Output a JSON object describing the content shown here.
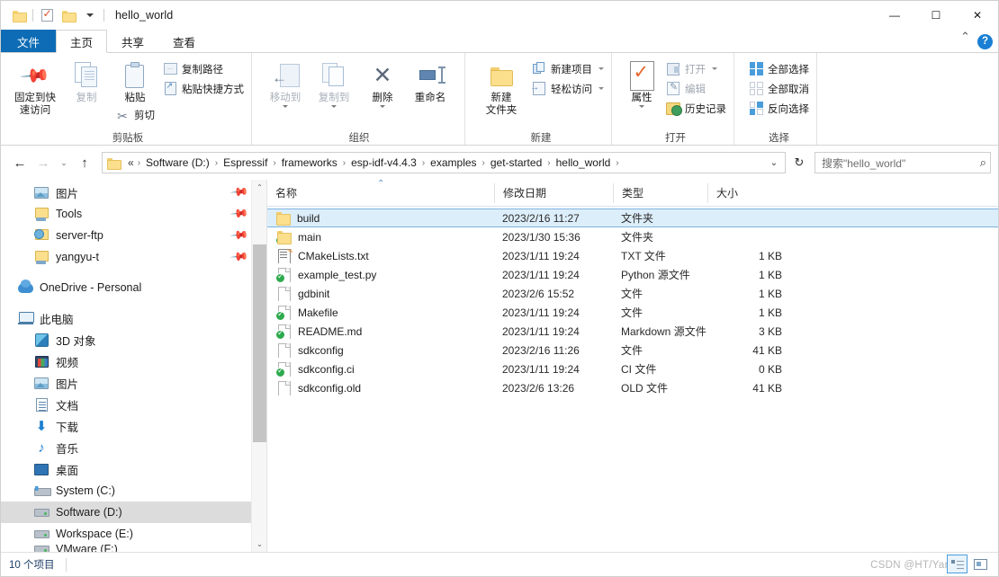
{
  "window": {
    "title": "hello_world",
    "minimize_label": "—",
    "maximize_label": "☐",
    "close_label": "✕"
  },
  "quick_access": {
    "folder_icon": "folder-icon",
    "properties_icon": "checkmark-document-icon",
    "new_folder_icon": "new-folder-icon",
    "customize_caret": "chevron-down-icon"
  },
  "ribbon": {
    "tabs": [
      {
        "label": "文件",
        "id": "file"
      },
      {
        "label": "主页",
        "id": "home"
      },
      {
        "label": "共享",
        "id": "share"
      },
      {
        "label": "查看",
        "id": "view"
      }
    ],
    "active_tab_index": 1,
    "collapse_icon": "chevron-up-icon",
    "help_icon": "help-question-icon",
    "help_label": "?",
    "groups": [
      {
        "label": "剪贴板",
        "big_buttons": [
          {
            "label": "固定到快\n速访问",
            "label_line1": "固定到快",
            "label_line2": "速访问",
            "icon": "pin-icon",
            "disabled": false
          },
          {
            "label": "复制",
            "icon": "copy-icon",
            "disabled": true
          },
          {
            "label": "粘贴",
            "icon": "paste-icon",
            "disabled": false
          }
        ],
        "small_buttons": [
          {
            "label": "复制路径",
            "icon": "copy-path-icon",
            "disabled": false
          },
          {
            "label": "粘贴快捷方式",
            "icon": "paste-shortcut-icon",
            "disabled": false
          },
          {
            "label": "剪切",
            "icon": "scissors-icon",
            "disabled": false
          }
        ]
      },
      {
        "label": "组织",
        "big_buttons": [
          {
            "label": "移动到",
            "icon": "move-to-icon",
            "disabled": true,
            "has_caret": true
          },
          {
            "label": "复制到",
            "icon": "copy-to-icon",
            "disabled": true,
            "has_caret": true
          },
          {
            "label": "删除",
            "icon": "delete-x-icon",
            "disabled": false,
            "has_caret": true
          },
          {
            "label": "重命名",
            "icon": "rename-icon",
            "disabled": false
          }
        ]
      },
      {
        "label": "新建",
        "big_buttons": [
          {
            "label_line1": "新建",
            "label_line2": "文件夹",
            "icon": "new-folder-icon",
            "disabled": false
          }
        ],
        "small_buttons": [
          {
            "label": "新建项目",
            "icon": "new-item-icon",
            "disabled": false,
            "has_caret": true
          },
          {
            "label": "轻松访问",
            "icon": "easy-access-icon",
            "disabled": false,
            "has_caret": true
          }
        ]
      },
      {
        "label": "打开",
        "big_buttons": [
          {
            "label": "属性",
            "icon": "properties-icon",
            "disabled": false,
            "has_caret": true
          }
        ],
        "small_buttons": [
          {
            "label": "打开",
            "icon": "open-icon",
            "disabled": true,
            "has_caret": true
          },
          {
            "label": "编辑",
            "icon": "edit-icon",
            "disabled": true
          },
          {
            "label": "历史记录",
            "icon": "history-icon",
            "disabled": false
          }
        ]
      },
      {
        "label": "选择",
        "small_buttons": [
          {
            "label": "全部选择",
            "icon": "select-all-icon",
            "disabled": false
          },
          {
            "label": "全部取消",
            "icon": "select-none-icon",
            "disabled": false
          },
          {
            "label": "反向选择",
            "icon": "invert-selection-icon",
            "disabled": false
          }
        ]
      }
    ]
  },
  "address_bar": {
    "back_icon": "arrow-left-icon",
    "forward_icon": "arrow-right-icon",
    "recent_icon": "chevron-down-icon",
    "up_icon": "arrow-up-icon",
    "folder_icon": "folder-icon",
    "prefix": "«",
    "breadcrumbs": [
      "Software (D:)",
      "Espressif",
      "frameworks",
      "esp-idf-v4.4.3",
      "examples",
      "get-started",
      "hello_world"
    ],
    "dropdown_icon": "chevron-down-icon",
    "refresh_icon": "refresh-icon"
  },
  "search": {
    "placeholder": "搜索\"hello_world\"",
    "icon": "search-magnifier-icon"
  },
  "sidebar": {
    "items": [
      {
        "label": "图片",
        "icon": "picture-icon",
        "indent": 1,
        "pinned": true
      },
      {
        "label": "Tools",
        "icon": "network-folder-icon",
        "indent": 1,
        "pinned": true
      },
      {
        "label": "server-ftp",
        "icon": "ftp-folder-icon",
        "indent": 1,
        "pinned": true
      },
      {
        "label": "yangyu-t",
        "icon": "network-folder-icon",
        "indent": 1,
        "pinned": true
      },
      {
        "label": "OneDrive - Personal",
        "icon": "onedrive-cloud-icon",
        "indent": 0,
        "spacer_above": true
      },
      {
        "label": "此电脑",
        "icon": "this-pc-icon",
        "indent": 0,
        "spacer_above": true
      },
      {
        "label": "3D 对象",
        "icon": "3d-objects-icon",
        "indent": 1
      },
      {
        "label": "视频",
        "icon": "videos-icon",
        "indent": 1
      },
      {
        "label": "图片",
        "icon": "picture-icon",
        "indent": 1
      },
      {
        "label": "文档",
        "icon": "documents-icon",
        "indent": 1
      },
      {
        "label": "下载",
        "icon": "downloads-icon",
        "indent": 1
      },
      {
        "label": "音乐",
        "icon": "music-icon",
        "indent": 1
      },
      {
        "label": "桌面",
        "icon": "desktop-icon",
        "indent": 1
      },
      {
        "label": "System (C:)",
        "icon": "system-drive-icon",
        "indent": 1
      },
      {
        "label": "Software (D:)",
        "icon": "drive-icon",
        "indent": 1,
        "selected": true
      },
      {
        "label": "Workspace (E:)",
        "icon": "drive-icon",
        "indent": 1
      },
      {
        "label": "VMware (F:)",
        "icon": "drive-icon",
        "indent": 1,
        "clipped": true
      }
    ],
    "scrollbar": {
      "up_icon": "chevron-up-icon",
      "down_icon": "chevron-down-icon"
    }
  },
  "file_list": {
    "columns": [
      {
        "label": "名称",
        "key": "name",
        "sorted": true,
        "sort_icon": "sort-ascending-icon"
      },
      {
        "label": "修改日期",
        "key": "date"
      },
      {
        "label": "类型",
        "key": "type"
      },
      {
        "label": "大小",
        "key": "size"
      }
    ],
    "rows": [
      {
        "name": "build",
        "date": "2023/2/16 11:27",
        "type": "文件夹",
        "size": "",
        "icon": "folder-icon",
        "selected": true
      },
      {
        "name": "main",
        "date": "2023/1/30 15:36",
        "type": "文件夹",
        "size": "",
        "icon": "folder-icon",
        "git": true
      },
      {
        "name": "CMakeLists.txt",
        "date": "2023/1/11 19:24",
        "type": "TXT 文件",
        "size": "1 KB",
        "icon": "text-file-icon",
        "pen": true
      },
      {
        "name": "example_test.py",
        "date": "2023/1/11 19:24",
        "type": "Python 源文件",
        "size": "1 KB",
        "icon": "file-icon",
        "git": true
      },
      {
        "name": "gdbinit",
        "date": "2023/2/6 15:52",
        "type": "文件",
        "size": "1 KB",
        "icon": "file-icon"
      },
      {
        "name": "Makefile",
        "date": "2023/1/11 19:24",
        "type": "文件",
        "size": "1 KB",
        "icon": "file-icon",
        "git": true
      },
      {
        "name": "README.md",
        "date": "2023/1/11 19:24",
        "type": "Markdown 源文件",
        "size": "3 KB",
        "icon": "file-icon",
        "git": true
      },
      {
        "name": "sdkconfig",
        "date": "2023/2/16 11:26",
        "type": "文件",
        "size": "41 KB",
        "icon": "file-icon"
      },
      {
        "name": "sdkconfig.ci",
        "date": "2023/1/11 19:24",
        "type": "CI 文件",
        "size": "0 KB",
        "icon": "file-icon",
        "git": true
      },
      {
        "name": "sdkconfig.old",
        "date": "2023/2/6 13:26",
        "type": "OLD 文件",
        "size": "41 KB",
        "icon": "file-icon"
      }
    ]
  },
  "status_bar": {
    "item_count": "10 个项目",
    "watermark": "CSDN @HT/Yang",
    "view_details_icon": "details-view-icon",
    "view_large_icons_icon": "large-icons-view-icon"
  },
  "colors": {
    "file_tab_blue": "#0d6cb5",
    "selection_fill": "#ddeefb",
    "selection_border": "#7cb3e0",
    "sidebar_selection": "#dcdcdc",
    "accent_blue": "#1a7fd4",
    "status_text": "#1c3d66"
  }
}
